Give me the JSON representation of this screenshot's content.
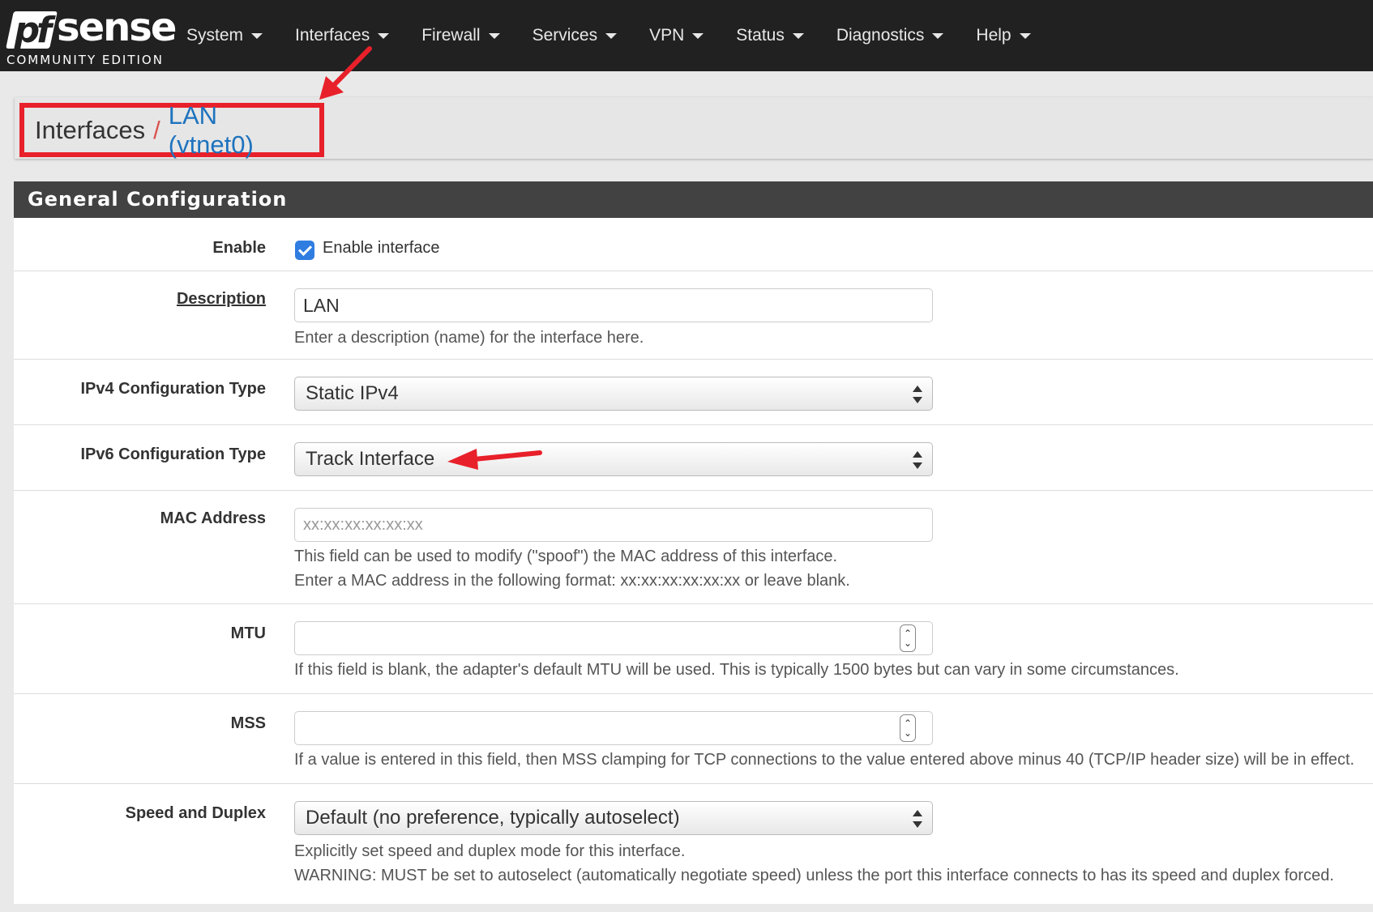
{
  "brand": {
    "logo_prefix": "pf",
    "logo_name": "sense",
    "edition": "COMMUNITY EDITION"
  },
  "nav": {
    "items": [
      {
        "label": "System"
      },
      {
        "label": "Interfaces"
      },
      {
        "label": "Firewall"
      },
      {
        "label": "Services"
      },
      {
        "label": "VPN"
      },
      {
        "label": "Status"
      },
      {
        "label": "Diagnostics"
      },
      {
        "label": "Help"
      }
    ]
  },
  "breadcrumb": {
    "root": "Interfaces",
    "separator": "/",
    "current": "LAN (vtnet0)"
  },
  "panel": {
    "title": "General Configuration",
    "enable": {
      "label": "Enable",
      "checkbox_label": "Enable interface",
      "checked": true
    },
    "description": {
      "label": "Description",
      "value": "LAN",
      "help": "Enter a description (name) for the interface here."
    },
    "ipv4": {
      "label": "IPv4 Configuration Type",
      "value": "Static IPv4"
    },
    "ipv6": {
      "label": "IPv6 Configuration Type",
      "value": "Track Interface"
    },
    "mac": {
      "label": "MAC Address",
      "placeholder": "xx:xx:xx:xx:xx:xx",
      "help1": "This field can be used to modify (\"spoof\") the MAC address of this interface.",
      "help2": "Enter a MAC address in the following format: xx:xx:xx:xx:xx:xx or leave blank."
    },
    "mtu": {
      "label": "MTU",
      "value": "",
      "help": "If this field is blank, the adapter's default MTU will be used. This is typically 1500 bytes but can vary in some circumstances."
    },
    "mss": {
      "label": "MSS",
      "value": "",
      "help": "If a value is entered in this field, then MSS clamping for TCP connections to the value entered above minus 40 (TCP/IP header size) will be in effect."
    },
    "speed": {
      "label": "Speed and Duplex",
      "value": "Default (no preference, typically autoselect)",
      "help1": "Explicitly set speed and duplex mode for this interface.",
      "help2": "WARNING: MUST be set to autoselect (automatically negotiate speed) unless the port this interface connects to has its speed and duplex forced."
    }
  },
  "colors": {
    "navbar": "#212121",
    "accent_link": "#1e73be",
    "annotation": "#e8202a",
    "panel_heading": "#424242",
    "checkbox": "#2f7de1"
  }
}
